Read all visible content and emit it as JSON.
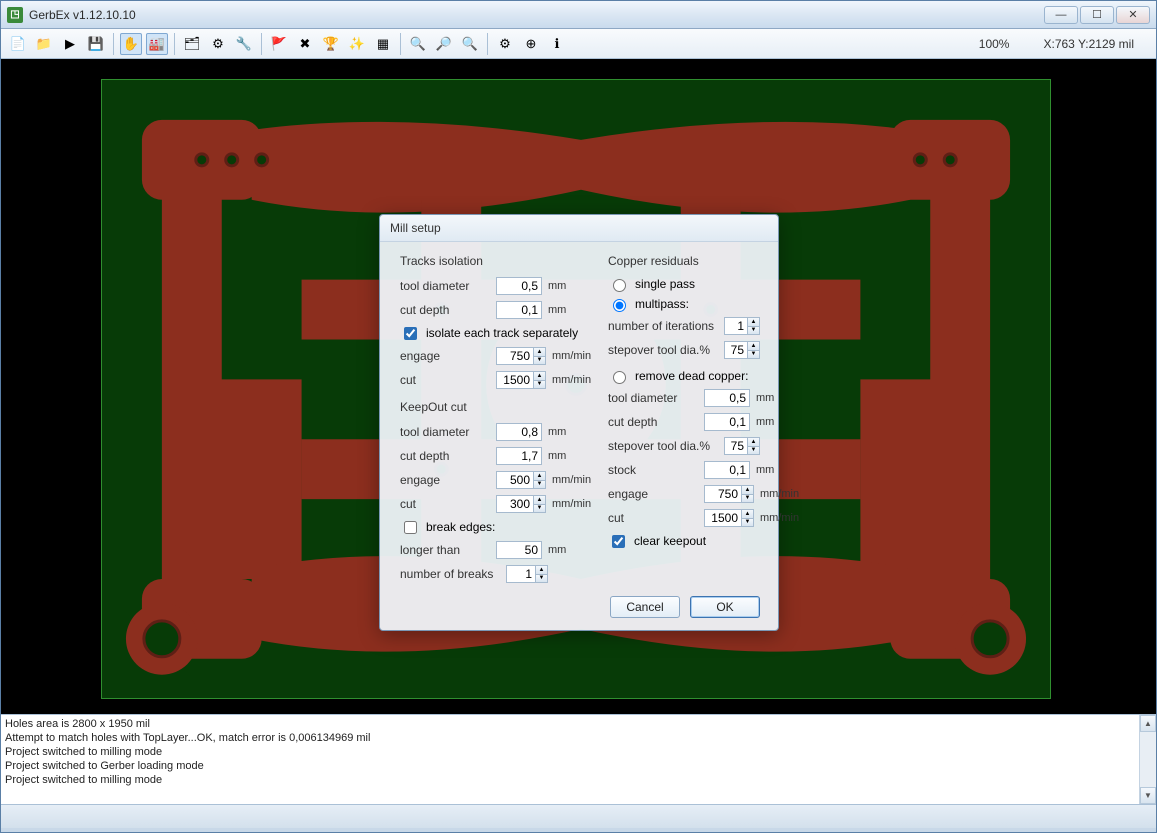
{
  "window": {
    "title": "GerbEx v1.12.10.10"
  },
  "toolbar": {
    "zoom": "100%",
    "coords": "X:763  Y:2129 mil",
    "icons": [
      "new-file-icon",
      "open-folder-icon",
      "save-icon",
      "save-as-icon",
      "hand-icon",
      "building-icon",
      "layers-icon",
      "config-icon",
      "tool-icon",
      "flag-red-icon",
      "x-red-icon",
      "trophy-icon",
      "wand-icon",
      "grid-icon",
      "zoom-in-icon",
      "zoom-out-icon",
      "zoom-fit-icon",
      "gear-icon",
      "target-icon",
      "info-icon"
    ],
    "glyphs": [
      "📄",
      "📁",
      "▶",
      "💾",
      "✋",
      "🏭",
      "🗂",
      "⚙",
      "🔧",
      "🚩",
      "✖",
      "🏆",
      "✨",
      "▦",
      "🔍",
      "🔎",
      "🔍",
      "⚙",
      "⊕",
      "ℹ"
    ]
  },
  "dialog": {
    "title": "Mill setup",
    "left": {
      "tracks_h": "Tracks isolation",
      "tool_dia_l": "tool diameter",
      "tool_dia_v": "0,5",
      "mm": "mm",
      "cut_depth_l": "cut depth",
      "cut_depth_v": "0,1",
      "isolate_l": "isolate each track separately",
      "isolate_checked": true,
      "engage_l": "engage",
      "engage_v": "750",
      "mmmin": "mm/min",
      "cut_l": "cut",
      "cut_v": "1500",
      "keepout_h": "KeepOut cut",
      "ko_tool_dia_v": "0,8",
      "ko_cut_depth_v": "1,7",
      "ko_engage_v": "500",
      "ko_cut_v": "300",
      "break_l": "break edges:",
      "break_checked": false,
      "longer_l": "longer than",
      "longer_v": "50",
      "nbreaks_l": "number of breaks",
      "nbreaks_v": "1"
    },
    "right": {
      "copper_h": "Copper residuals",
      "single_l": "single pass",
      "multi_l": "multipass:",
      "multi_selected": true,
      "niter_l": "number of iterations",
      "niter_v": "1",
      "step_l": "stepover tool dia.%",
      "step_v": "75",
      "remove_l": "remove dead copper:",
      "tool_dia_l": "tool diameter",
      "tool_dia_v": "0,5",
      "mm": "mm",
      "cut_depth_l": "cut depth",
      "cut_depth_v": "0,1",
      "step2_v": "75",
      "stock_l": "stock",
      "stock_v": "0,1",
      "engage_l": "engage",
      "engage_v": "750",
      "mmmin": "mm/min",
      "cut_l": "cut",
      "cut_v": "1500",
      "clear_l": "clear keepout",
      "clear_checked": true
    },
    "cancel": "Cancel",
    "ok": "OK"
  },
  "log": {
    "lines": [
      "Holes area is 2800 x 1950 mil",
      "Attempt to match holes with TopLayer...OK, match error is 0,006134969 mil",
      "Project switched to milling mode",
      "Project switched to Gerber loading mode",
      "Project switched to milling mode"
    ]
  }
}
